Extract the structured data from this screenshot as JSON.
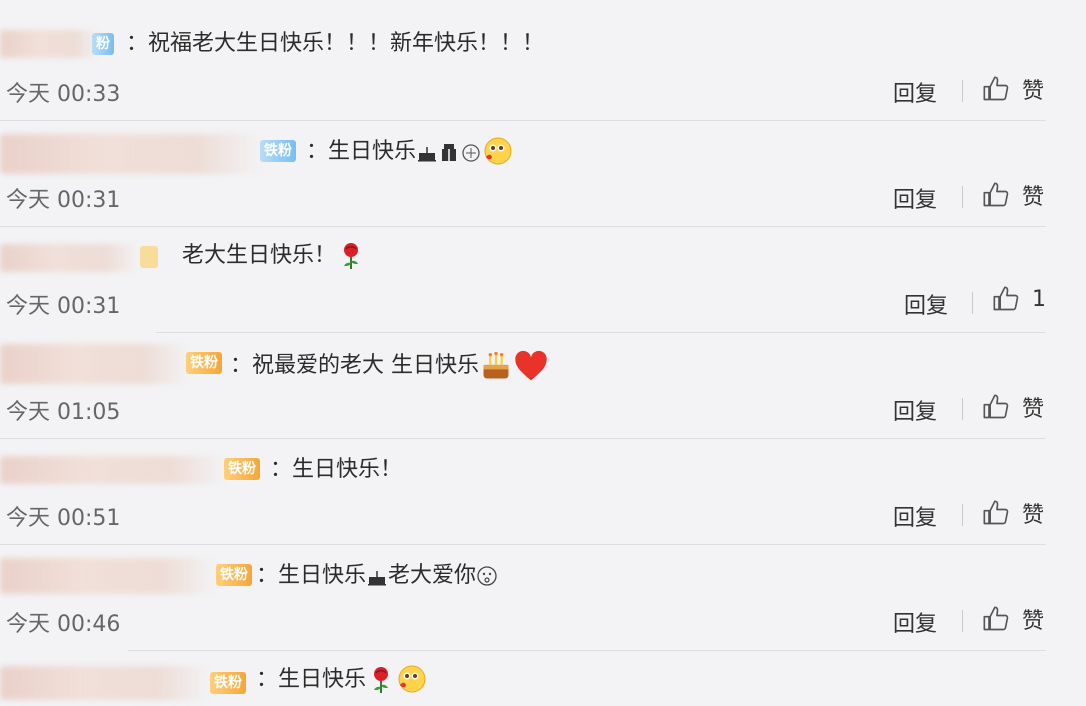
{
  "comments": [
    {
      "badge": "粉",
      "text": "：祝福老大生日快乐！！！新年快乐！！！",
      "time": "今天 00:33",
      "reply": "回复",
      "like": "赞"
    },
    {
      "badge": "铁粉",
      "text": "：生日快乐",
      "time": "今天 00:31",
      "reply": "回复",
      "like": "赞"
    },
    {
      "badge": "",
      "text": "老大生日快乐！",
      "time": "今天 00:31",
      "reply": "回复",
      "like": "1"
    },
    {
      "badge": "铁粉",
      "text": "：祝最爱的老大 生日快乐",
      "time": "今天 01:05",
      "reply": "回复",
      "like": "赞"
    },
    {
      "badge": "铁粉",
      "text": "：生日快乐！",
      "time": "今天 00:51",
      "reply": "回复",
      "like": "赞"
    },
    {
      "badge": "铁粉",
      "text_a": "：生日快乐",
      "text_b": "老大爱你",
      "time": "今天 00:46",
      "reply": "回复",
      "like": "赞"
    },
    {
      "badge": "铁粉",
      "text": "：生日快乐"
    }
  ],
  "icons": {
    "thumb": "thumbs-up-icon",
    "cake": "cake-icon",
    "rose": "rose-icon",
    "heart": "heart-icon",
    "blush": "blush-face-icon"
  },
  "colors": {
    "background": "#f3f3f5",
    "badge_blue": "#79bdf0",
    "badge_orange": "#f5a63a",
    "heart": "#e8322a"
  }
}
